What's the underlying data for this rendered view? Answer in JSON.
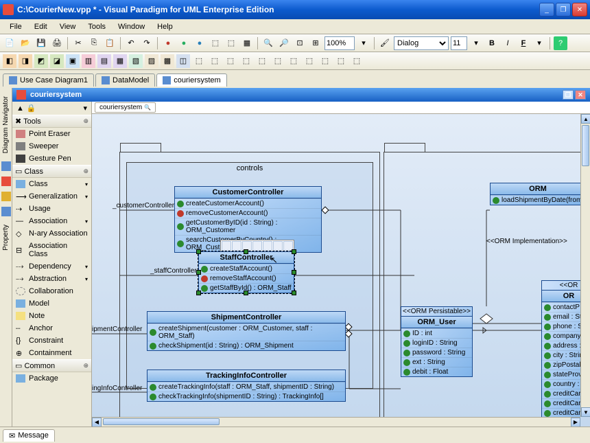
{
  "window": {
    "title": "C:\\CourierNew.vpp * - Visual Paradigm for UML Enterprise Edition"
  },
  "menu": [
    "File",
    "Edit",
    "View",
    "Tools",
    "Window",
    "Help"
  ],
  "zoom": "100%",
  "font": "Dialog",
  "fontSize": "11",
  "tabs": [
    {
      "label": "Use Case Diagram1"
    },
    {
      "label": "DataModel"
    },
    {
      "label": "couriersystem"
    }
  ],
  "innerTitle": "couriersystem",
  "stripTabs": [
    "Diagram Navigator",
    "Property"
  ],
  "palette": {
    "tools": {
      "title": "Tools",
      "items": [
        "Point Eraser",
        "Sweeper",
        "Gesture Pen"
      ]
    },
    "class": {
      "title": "Class",
      "items": [
        "Class",
        "Generalization",
        "Usage",
        "Association",
        "N-ary Association",
        "Association Class",
        "Dependency",
        "Abstraction",
        "Collaboration",
        "Model",
        "Note",
        "Anchor",
        "Constraint",
        "Containment"
      ]
    },
    "common": {
      "title": "Common",
      "items": [
        "Package"
      ]
    }
  },
  "crumb": "couriersystem",
  "diagram": {
    "pkgLabel": "controls",
    "ormImpl": "<<ORM Implementation>>",
    "customer": {
      "name": "CustomerController",
      "role": "_customerController",
      "ops": [
        "createCustomerAccount()",
        "removeCustomerAccount()",
        "getCustomerByID(id : String) : ORM_Customer",
        "searchCustomerByCountry() : ORM_Customer"
      ]
    },
    "staff": {
      "name": "StaffController",
      "role": "_staffController",
      "ops": [
        "createStaffAccount()",
        "removeStaffAccount()",
        "getStaffById() : ORM_Staff"
      ]
    },
    "shipment": {
      "name": "ShipmentController",
      "role": "ipmentController",
      "ops": [
        "createShipment(customer : ORM_Customer, staff : ORM_Staff)",
        "checkShipment(id : String) : ORM_Shipment"
      ]
    },
    "tracking": {
      "name": "TrackingInfoController",
      "role": "ingInfoController",
      "ops": [
        "createTrackingInfo(staff : ORM_Staff, shipmentID : String)",
        "checkTrackingInfo(shipmentID : String) : TrackingInfo[]"
      ]
    },
    "ormUser": {
      "stereo": "<<ORM Persistable>>",
      "name": "ORM_User",
      "attrs": [
        "ID : int",
        "loginID : String",
        "password : String",
        "ext : String",
        "debit : Float"
      ]
    },
    "ormRight": {
      "head1": "ORM",
      "op": "loadShipmentByDate(from",
      "head2": "<<OR",
      "head3": "OR",
      "attrs": [
        "contactP",
        "email : St",
        "phone : S",
        "company",
        "address :",
        "city : Strin",
        "zipPostal",
        "stateProv",
        "country :",
        "creditCar",
        "creditCar",
        "creditCar"
      ]
    }
  },
  "status": {
    "message": "Message"
  }
}
